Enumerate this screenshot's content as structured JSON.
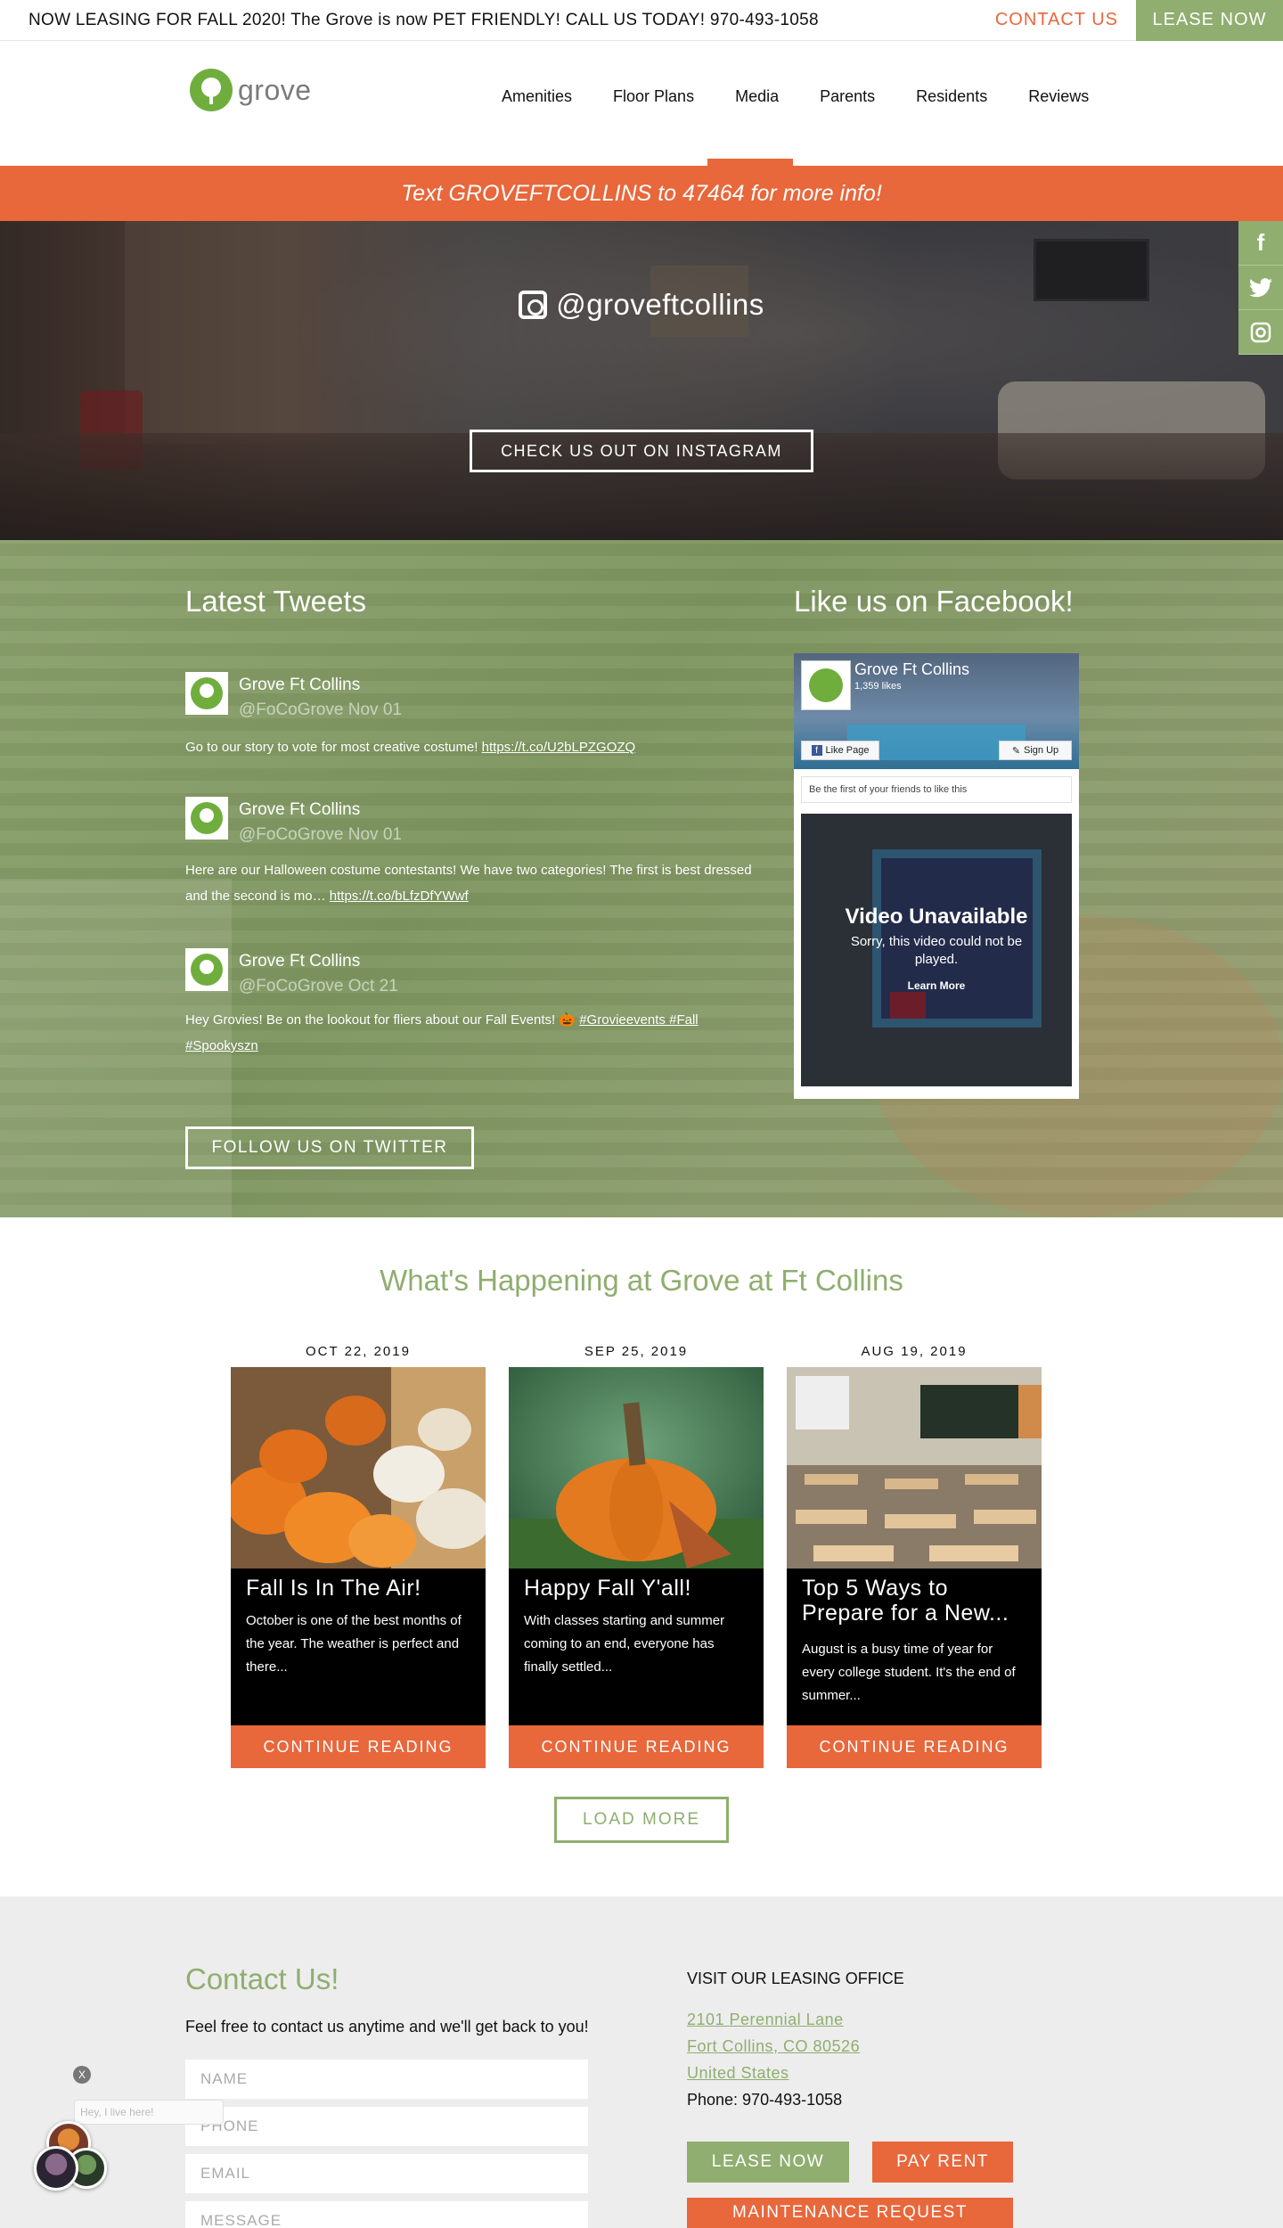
{
  "topbar": {
    "announcement": "NOW LEASING FOR FALL 2020! The Grove is now PET FRIENDLY! CALL US TODAY! 970-493-1058",
    "contact_label": "CONTACT US",
    "lease_label": "LEASE NOW"
  },
  "header": {
    "logo_text": "grove",
    "nav": [
      "Amenities",
      "Floor Plans",
      "Media",
      "Parents",
      "Residents",
      "Reviews"
    ],
    "active_nav": "Media"
  },
  "text_banner": "Text GROVEFTCOLLINS to 47464 for more info!",
  "instagram": {
    "handle": "@groveftcollins",
    "button": "CHECK US OUT ON INSTAGRAM"
  },
  "social_sidebar": [
    {
      "icon": "facebook-icon",
      "glyph": "f"
    },
    {
      "icon": "twitter-icon",
      "glyph": "🐦"
    },
    {
      "icon": "instagram-icon",
      "glyph": "◎"
    }
  ],
  "tweets": {
    "heading": "Latest Tweets",
    "items": [
      {
        "name": "Grove Ft Collins",
        "meta": "@FoCoGrove Nov 01",
        "text": "Go to our story to vote for most creative costume! ",
        "link": "https://t.co/U2bLPZGOZQ"
      },
      {
        "name": "Grove Ft Collins",
        "meta": "@FoCoGrove Nov 01",
        "text": "Here are our Halloween costume contestants! We have two categories! The first is best dressed and the second is mo… ",
        "link": "https://t.co/bLfzDfYWwf"
      },
      {
        "name": "Grove Ft Collins",
        "meta": "@FoCoGrove Oct 21",
        "text": "Hey Grovies! Be on the lookout for fliers about our Fall Events! 🎃 ",
        "link": "#Grovieevents #Fall #Spookyszn"
      }
    ],
    "follow_button": "FOLLOW US ON TWITTER"
  },
  "facebook": {
    "heading": "Like us on Facebook!",
    "page_name": "Grove Ft Collins",
    "likes": "1,359 likes",
    "like_button": "Like Page",
    "signup_button": "Sign Up",
    "friends_text": "Be the first of your friends to like this",
    "video_title": "Video Unavailable",
    "video_sub": "Sorry, this video could not be played.",
    "video_link": "Learn More"
  },
  "blog": {
    "heading": "What's Happening at Grove at Ft Collins",
    "posts": [
      {
        "date": "OCT 22, 2019",
        "title": "Fall Is In The Air!",
        "excerpt": "October is one of the best months of the year. The weather is perfect and there...",
        "cta": "CONTINUE READING"
      },
      {
        "date": "SEP 25, 2019",
        "title": "Happy Fall Y'all!",
        "excerpt": "With classes starting and summer coming to an end, everyone has finally settled...",
        "cta": "CONTINUE READING"
      },
      {
        "date": "AUG 19, 2019",
        "title": "Top 5 Ways to Prepare for a New...",
        "excerpt": "August is a busy time of year for every college student. It's the end of summer...",
        "cta": "CONTINUE READING"
      }
    ],
    "load_more": "LOAD MORE"
  },
  "contact": {
    "heading": "Contact Us!",
    "subtext": "Feel free to contact us anytime and we'll get back to you!",
    "fields": {
      "name": "NAME",
      "phone": "PHONE",
      "email": "EMAIL",
      "message": "MESSAGE"
    },
    "office_heading": "VISIT OUR LEASING OFFICE",
    "address": [
      "2101 Perennial Lane",
      "Fort Collins, CO 80526",
      "United States"
    ],
    "phone": "Phone: 970-493-1058",
    "buttons": {
      "lease": "LEASE NOW",
      "pay": "PAY RENT",
      "maintenance": "MAINTENANCE REQUEST"
    }
  },
  "chat": {
    "close": "X",
    "bubble": "Hey, I live here!"
  },
  "colors": {
    "accent_orange": "#e8673b",
    "brand_green": "#8fae6f",
    "logo_green": "#6fae3d"
  }
}
